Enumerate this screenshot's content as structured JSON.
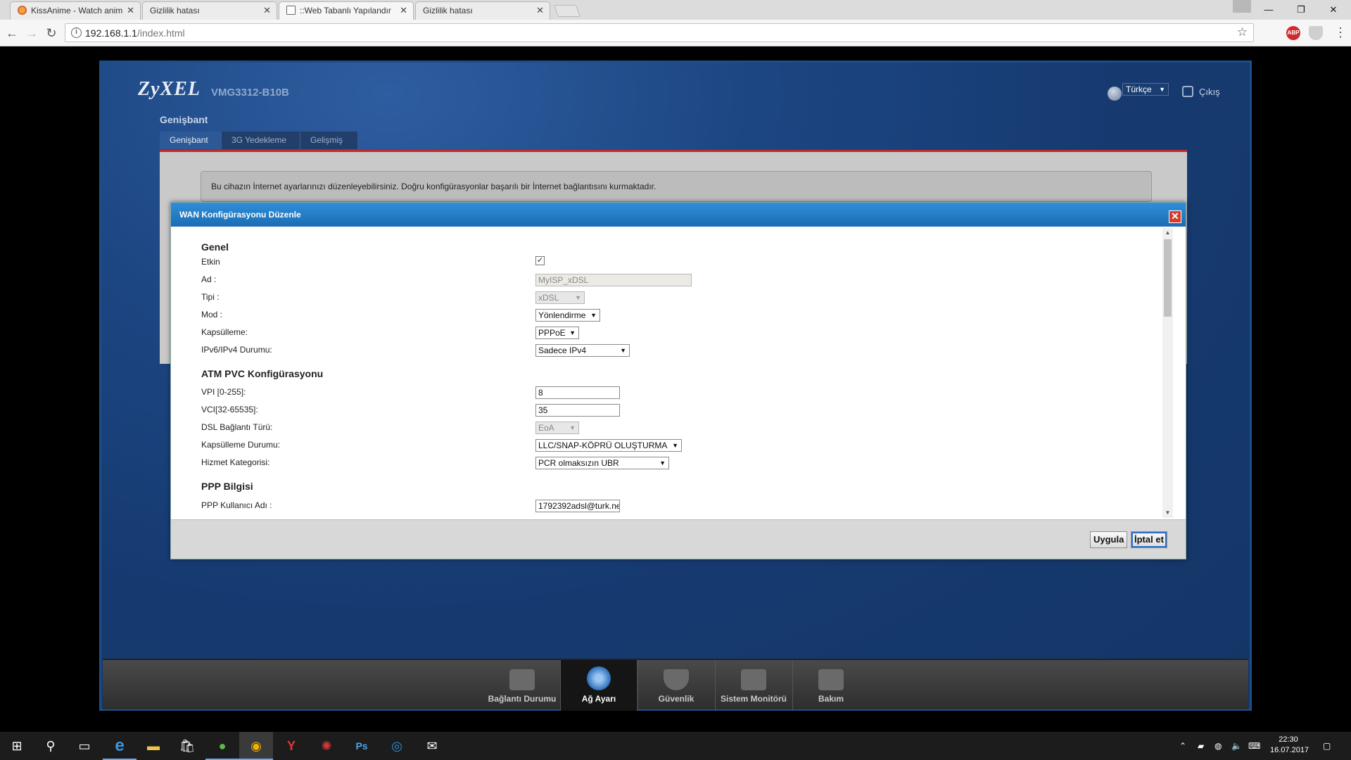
{
  "browser": {
    "tabs": [
      {
        "title": "KissAnime - Watch anim",
        "active": false
      },
      {
        "title": "Gizlilik hatası",
        "active": false
      },
      {
        "title": "::Web Tabanlı Yapılandır",
        "active": true
      },
      {
        "title": "Gizlilik hatası",
        "active": false
      }
    ],
    "url_host": "192.168.1.1",
    "url_path": "/index.html",
    "extensions": [
      "adblock-icon",
      "shield-icon"
    ]
  },
  "router": {
    "logo": "ZyXEL",
    "model": "VMG3312-B10B",
    "language": "Türkçe",
    "logout": "Çıkış",
    "section_title": "Genişbant",
    "subtabs": [
      "Genişbant",
      "3G Yedekleme",
      "Gelişmiş"
    ],
    "info_text": "Bu cihazın İnternet ayarlarınızı düzenleyebilirsiniz. Doğru konfigürasyonlar başarılı bir İnternet bağlantısını kurmaktadır."
  },
  "modal": {
    "title": "WAN Konfigürasyonu Düzenle",
    "groups": {
      "general": "Genel",
      "atm": "ATM PVC Konfigürasyonu",
      "ppp": "PPP Bilgisi"
    },
    "fields": {
      "etkin_label": "Etkin",
      "etkin_checked": true,
      "ad_label": "Ad :",
      "ad_value": "MyISP_xDSL",
      "tipi_label": "Tipi :",
      "tipi_value": "xDSL",
      "mod_label": "Mod :",
      "mod_value": "Yönlendirme",
      "kapsulleme_label": "Kapsülleme:",
      "kapsulleme_value": "PPPoE",
      "ipv_label": "IPv6/IPv4 Durumu:",
      "ipv_value": "Sadece IPv4",
      "vpi_label": "VPI [0-255]:",
      "vpi_value": "8",
      "vci_label": "VCI[32-65535]:",
      "vci_value": "35",
      "dsl_label": "DSL Bağlantı Türü:",
      "dsl_value": "EoA",
      "kaps_durum_label": "Kapsülleme Durumu:",
      "kaps_durum_value": "LLC/SNAP-KÖPRÜ OLUŞTURMA",
      "hizmet_label": "Hizmet Kategorisi:",
      "hizmet_value": "PCR olmaksızın UBR",
      "ppp_user_label": "PPP Kullanıcı Adı :",
      "ppp_user_value": "1792392adsl@turk.ne"
    },
    "apply": "Uygula",
    "cancel": "İptal et"
  },
  "dock": [
    {
      "label": "Bağlantı Durumu",
      "icon": "connection-status-icon",
      "active": false
    },
    {
      "label": "Ağ Ayarı",
      "icon": "network-setting-icon",
      "active": true
    },
    {
      "label": "Güvenlik",
      "icon": "security-icon",
      "active": false
    },
    {
      "label": "Sistem Monitörü",
      "icon": "system-monitor-icon",
      "active": false
    },
    {
      "label": "Bakım",
      "icon": "maintenance-icon",
      "active": false
    }
  ],
  "taskbar": {
    "apps": [
      "windows-start-icon",
      "search-icon",
      "task-view-icon",
      "edge-icon",
      "file-explorer-icon",
      "store-icon",
      "utorrent-icon",
      "chrome-icon",
      "yandex-icon",
      "app-red-icon",
      "photoshop-icon",
      "ccleaner-icon",
      "mail-icon"
    ],
    "time": "22:30",
    "date": "16.07.2017"
  }
}
